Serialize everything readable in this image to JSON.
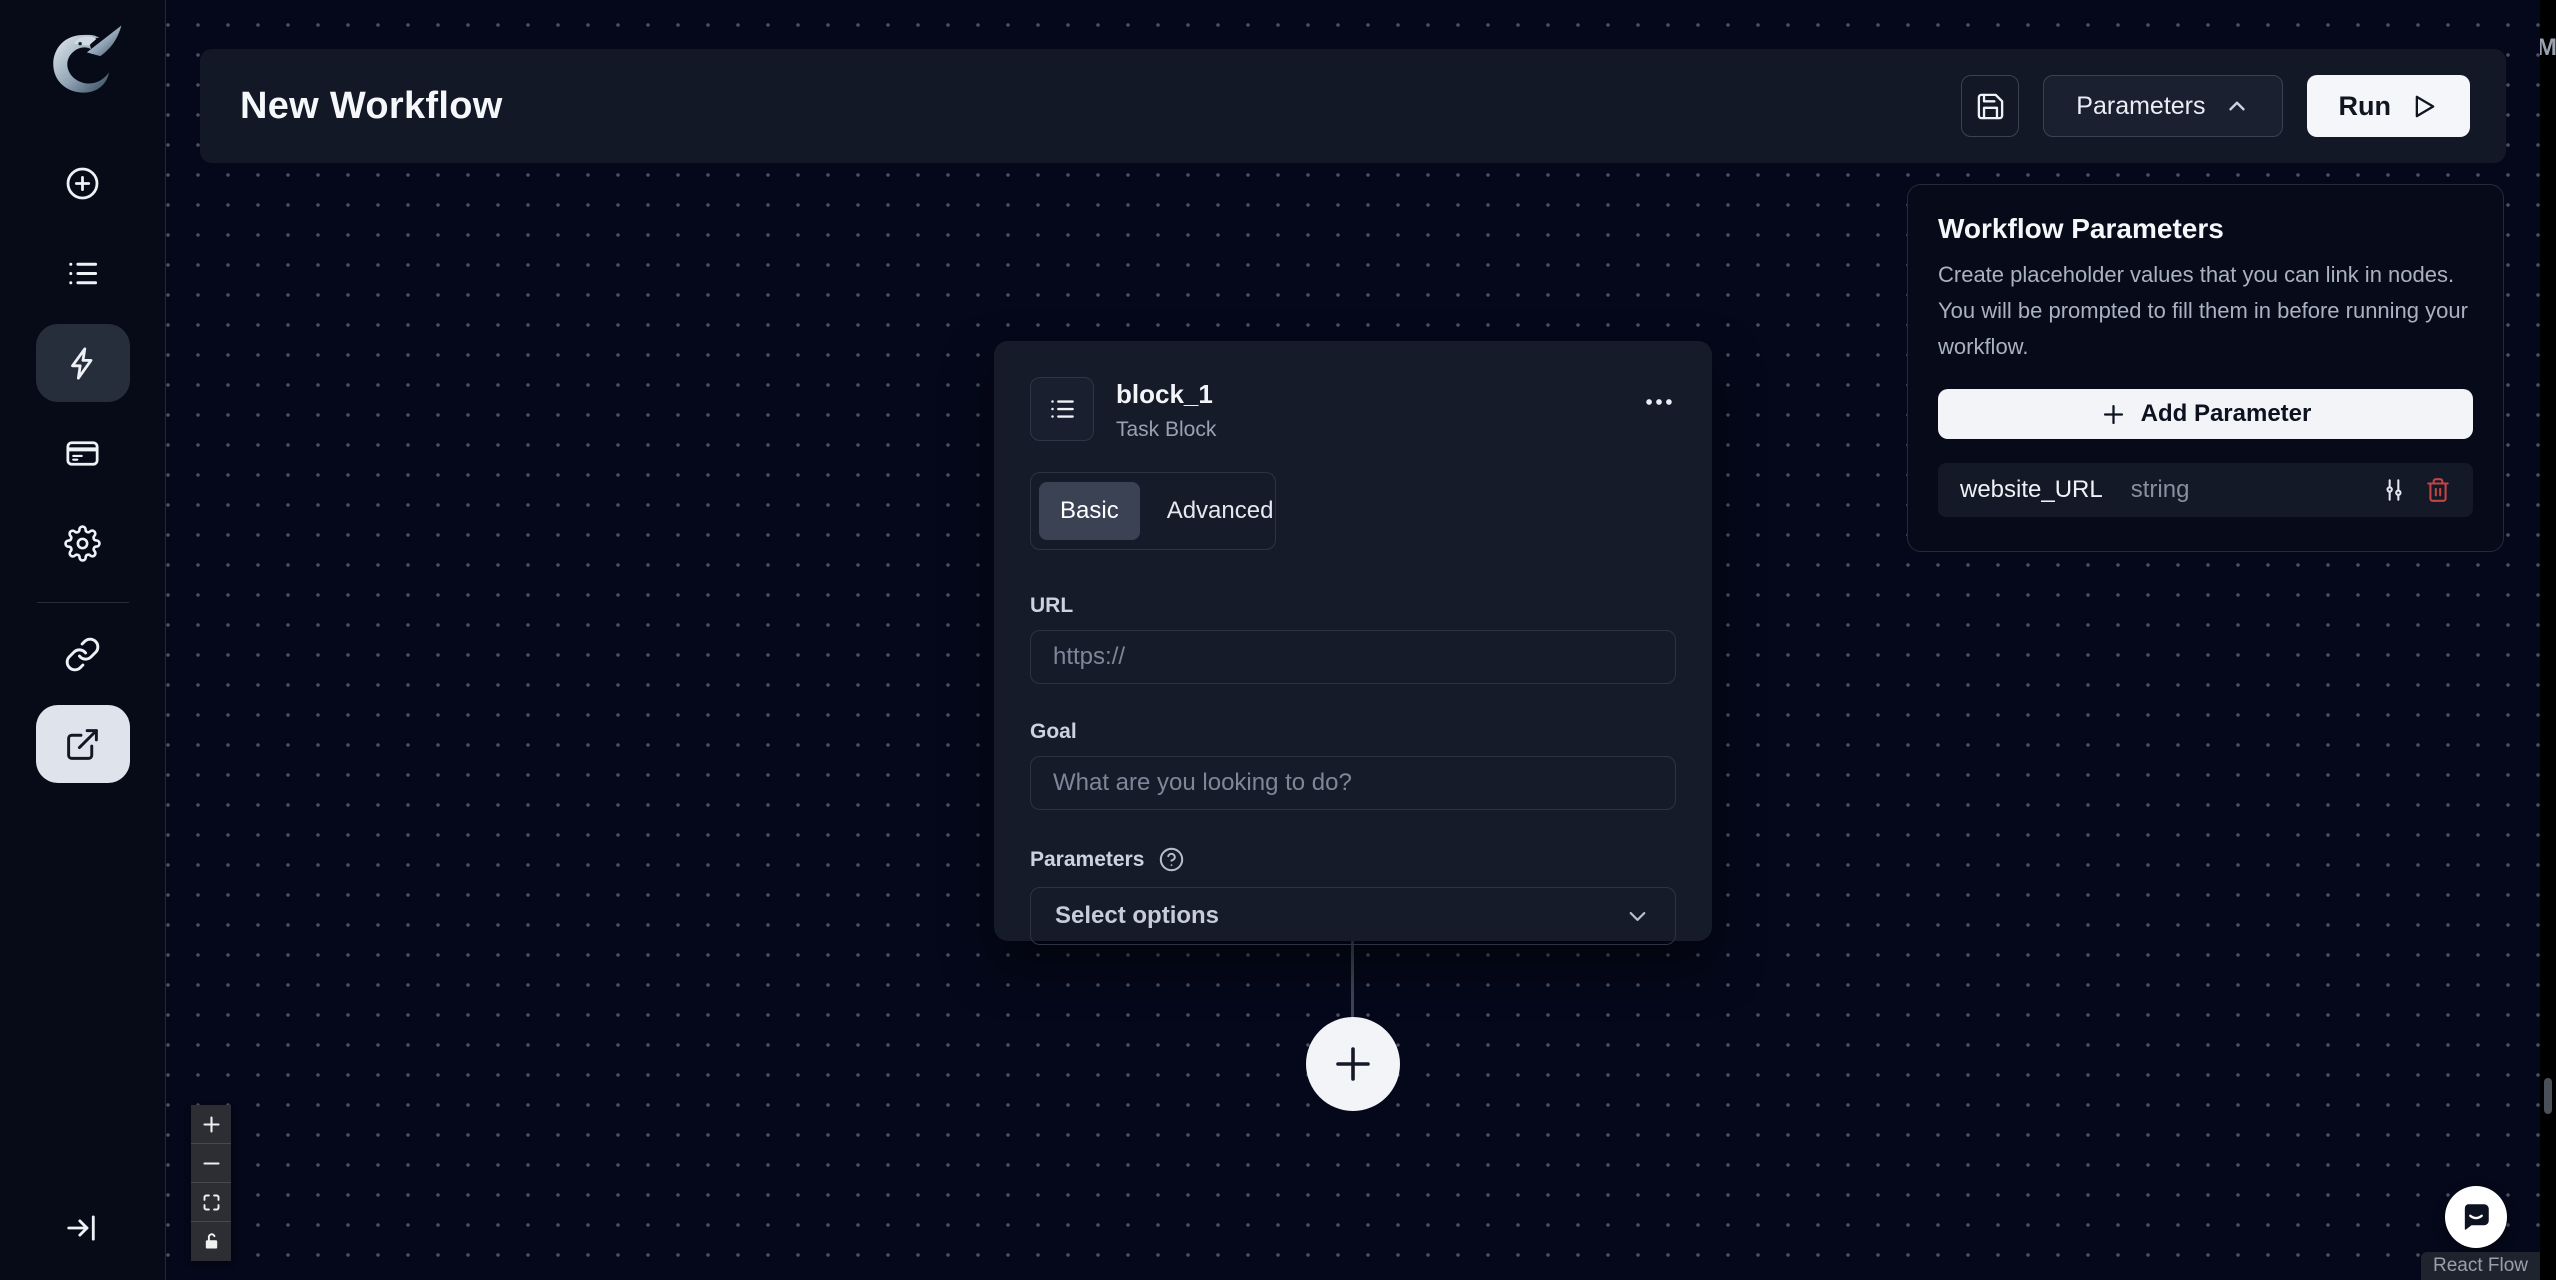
{
  "header": {
    "title": "New Workflow",
    "save_icon": "save-icon",
    "parameters_label": "Parameters",
    "parameters_icon": "chevron-up-icon",
    "run_label": "Run",
    "run_icon": "play-icon"
  },
  "sidebar": {
    "logo": "skyvern-dragon-logo",
    "nav": [
      {
        "name": "create",
        "icon": "plus-circle-icon",
        "active": false
      },
      {
        "name": "tasks",
        "icon": "list-icon",
        "active": false
      },
      {
        "name": "workflows",
        "icon": "lightning-icon",
        "active": true
      },
      {
        "name": "billing",
        "icon": "credit-card-icon",
        "active": false
      },
      {
        "name": "settings",
        "icon": "gear-icon",
        "active": false
      },
      {
        "name": "integrations",
        "icon": "link-icon",
        "active": false
      },
      {
        "name": "share",
        "icon": "external-link-icon",
        "active": true
      }
    ],
    "collapse_icon": "collapse-sidebar-icon"
  },
  "block": {
    "icon": "task-list-icon",
    "title": "block_1",
    "subtitle": "Task Block",
    "menu_icon": "ellipsis-icon",
    "tabs": [
      "Basic",
      "Advanced"
    ],
    "active_tab": "Basic",
    "url_label": "URL",
    "url_placeholder": "https://",
    "url_value": "",
    "goal_label": "Goal",
    "goal_placeholder": "What are you looking to do?",
    "goal_value": "",
    "parameters_label": "Parameters",
    "parameters_help_icon": "help-circle-icon",
    "select_placeholder": "Select options",
    "select_icon": "chevron-down-icon"
  },
  "canvas": {
    "add_node_icon": "plus-icon",
    "attribution": "React Flow",
    "zoom_controls": [
      "zoom-in-icon",
      "zoom-out-icon",
      "fit-view-icon",
      "unlock-icon"
    ]
  },
  "parameters_panel": {
    "title": "Workflow Parameters",
    "description": "Create placeholder values that you can link in nodes. You will be prompted to fill them in before running your workflow.",
    "add_label": "Add Parameter",
    "add_icon": "plus-icon",
    "rows": [
      {
        "name": "website_URL",
        "type": "string",
        "icons": [
          "sliders-icon",
          "trash-icon"
        ]
      }
    ]
  },
  "messenger": {
    "icon": "chat-bubble-icon"
  },
  "strip": {
    "clipped_text": "M"
  },
  "colors": {
    "canvas_bg": "#05081a",
    "header_bg": "#131826",
    "card_bg": "#161b2a",
    "active_nav_dark": "#262d3b",
    "active_nav_light": "#dfe4ec",
    "active_tab": "#3a4253",
    "light_button": "#f4f6f9",
    "danger": "#c04545",
    "border": "#2c3444"
  }
}
